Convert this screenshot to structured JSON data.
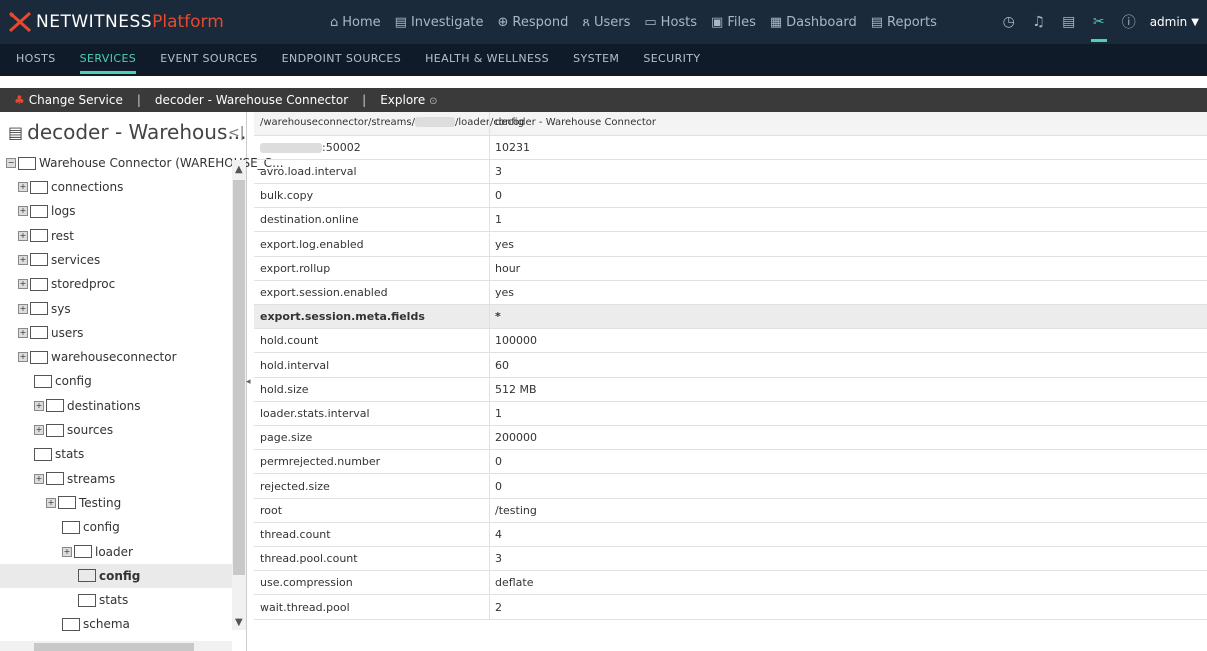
{
  "brand": {
    "name": "NETWITNESS",
    "product": "Platform"
  },
  "nav": [
    {
      "icon": "home-icon",
      "glyph": "⌂",
      "label": "Home"
    },
    {
      "icon": "investigate-icon",
      "glyph": "▤",
      "label": "Investigate"
    },
    {
      "icon": "respond-icon",
      "glyph": "⊕",
      "label": "Respond"
    },
    {
      "icon": "users-icon",
      "glyph": "ጸ",
      "label": "Users"
    },
    {
      "icon": "hosts-icon",
      "glyph": "▭",
      "label": "Hosts"
    },
    {
      "icon": "files-icon",
      "glyph": "▣",
      "label": "Files"
    },
    {
      "icon": "dashboard-icon",
      "glyph": "▦",
      "label": "Dashboard"
    },
    {
      "icon": "reports-icon",
      "glyph": "▤",
      "label": "Reports"
    }
  ],
  "user": {
    "name": "admin"
  },
  "subnav": [
    "HOSTS",
    "SERVICES",
    "EVENT SOURCES",
    "ENDPOINT SOURCES",
    "HEALTH & WELLNESS",
    "SYSTEM",
    "SECURITY"
  ],
  "servicebar": {
    "change": "Change Service",
    "service": "decoder - Warehouse Connector",
    "explore": "Explore"
  },
  "tree": {
    "title": "decoder - Warehous...",
    "root": "Warehouse Connector (WAREHOUSE_C...",
    "nodes": [
      "connections",
      "logs",
      "rest",
      "services",
      "storedproc",
      "sys",
      "users",
      "warehouseconnector",
      "config",
      "destinations",
      "sources",
      "stats",
      "streams",
      "Testing",
      "config",
      "loader",
      "config",
      "stats",
      "schema"
    ]
  },
  "grid": {
    "path_pre": "/warehouseconnector/streams/",
    "path_post": "/loader/config",
    "header_value": "decoder - Warehouse Connector",
    "first_key_suffix": ":50002",
    "first_value": "10231",
    "rows": [
      {
        "k": "avro.load.interval",
        "v": "3"
      },
      {
        "k": "bulk.copy",
        "v": "0"
      },
      {
        "k": "destination.online",
        "v": "1"
      },
      {
        "k": "export.log.enabled",
        "v": "yes"
      },
      {
        "k": "export.rollup",
        "v": "hour"
      },
      {
        "k": "export.session.enabled",
        "v": "yes"
      },
      {
        "k": "export.session.meta.fields",
        "v": "*"
      },
      {
        "k": "hold.count",
        "v": "100000"
      },
      {
        "k": "hold.interval",
        "v": "60"
      },
      {
        "k": "hold.size",
        "v": "512 MB"
      },
      {
        "k": "loader.stats.interval",
        "v": "1"
      },
      {
        "k": "page.size",
        "v": "200000"
      },
      {
        "k": "permrejected.number",
        "v": "0"
      },
      {
        "k": "rejected.size",
        "v": "0"
      },
      {
        "k": "root",
        "v": "/testing"
      },
      {
        "k": "thread.count",
        "v": "4"
      },
      {
        "k": "thread.pool.count",
        "v": "3"
      },
      {
        "k": "use.compression",
        "v": "deflate"
      },
      {
        "k": "wait.thread.pool",
        "v": "2"
      }
    ]
  }
}
